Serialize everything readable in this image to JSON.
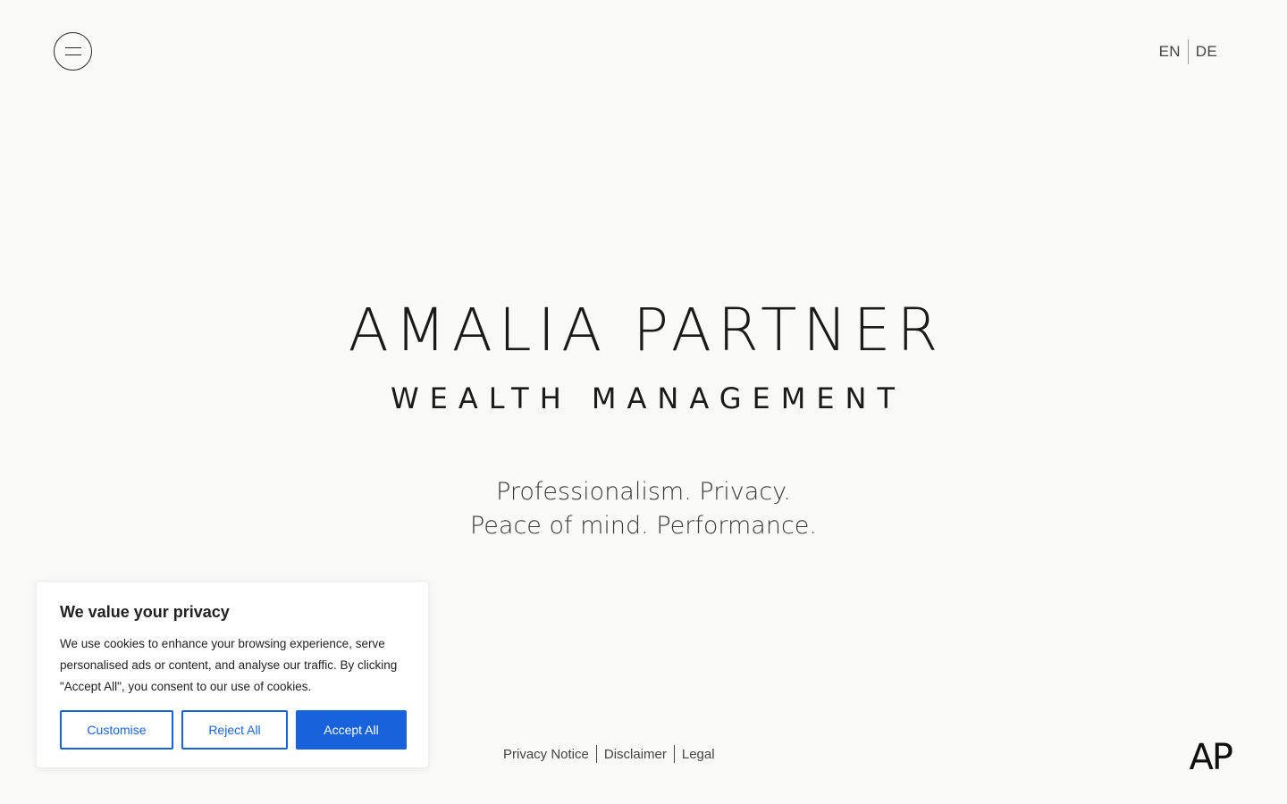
{
  "header": {
    "menu_icon": "hamburger-icon",
    "languages": [
      "EN",
      "DE"
    ]
  },
  "hero": {
    "title": "AMALIA PARTNER",
    "subtitle": "WEALTH MANAGEMENT",
    "tagline_line1": "Professionalism. Privacy.",
    "tagline_line2": "Peace of mind. Performance."
  },
  "footer": {
    "links": [
      "Privacy Notice",
      "Disclaimer",
      "Legal"
    ],
    "logo": "AP"
  },
  "cookie_banner": {
    "title": "We value your privacy",
    "text": "We use cookies to enhance your browsing experience, serve personalised ads or content, and analyse our traffic. By clicking \"Accept All\", you consent to our use of cookies.",
    "customise_label": "Customise",
    "reject_label": "Reject All",
    "accept_label": "Accept All",
    "accent_color": "#1863dc"
  }
}
